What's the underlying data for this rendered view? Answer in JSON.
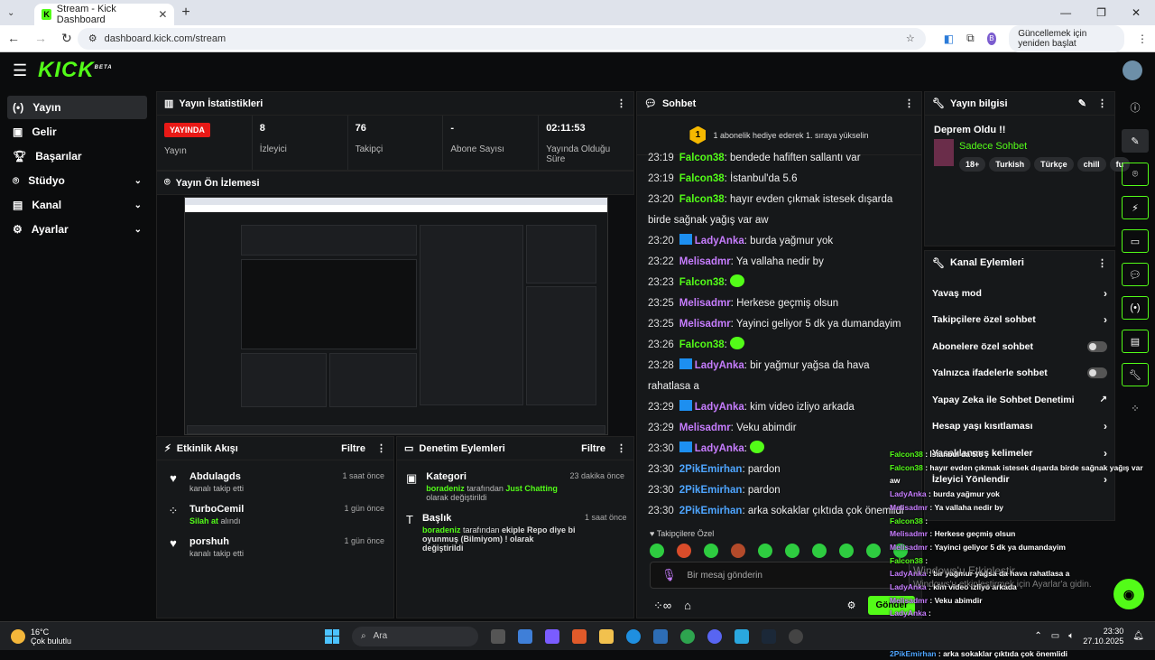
{
  "browser": {
    "tab_title": "Stream - Kick Dashboard",
    "url": "dashboard.kick.com/stream",
    "update_button": "Güncellemek için yeniden başlat",
    "profile_initial": "B"
  },
  "app": {
    "logo": "KICK",
    "logo_sup": "BETA"
  },
  "sidebar": {
    "items": [
      {
        "label": "Yayın",
        "icon": "broadcast-icon",
        "active": true
      },
      {
        "label": "Gelir",
        "icon": "revenue-icon"
      },
      {
        "label": "Başarılar",
        "icon": "trophy-icon"
      },
      {
        "label": "Stüdyo",
        "icon": "studio-icon",
        "expandable": true
      },
      {
        "label": "Kanal",
        "icon": "channel-icon",
        "expandable": true
      },
      {
        "label": "Ayarlar",
        "icon": "settings-icon",
        "expandable": true
      }
    ]
  },
  "stats": {
    "title": "Yayın İstatistikleri",
    "live_badge": "YAYINDA",
    "items": [
      {
        "value": "",
        "label": "Yayın"
      },
      {
        "value": "8",
        "label": "İzleyici"
      },
      {
        "value": "76",
        "label": "Takipçi"
      },
      {
        "value": "-",
        "label": "Abone Sayısı"
      },
      {
        "value": "02:11:53",
        "label": "Yayında Olduğu Süre"
      }
    ]
  },
  "preview": {
    "title": "Yayın Ön İzlemesi"
  },
  "activity": {
    "title": "Etkinlik Akışı",
    "filter": "Filtre",
    "rows": [
      {
        "name": "Abdulagds",
        "desc": "kanalı takip etti",
        "time": "1 saat önce",
        "icon": "heart-icon"
      },
      {
        "name": "TurboCemil",
        "desc_highlight": "Silah at",
        "desc": "alındı",
        "time": "1 gün önce",
        "icon": "reward-icon"
      },
      {
        "name": "porshuh",
        "desc": "kanalı takip etti",
        "time": "1 gün önce",
        "icon": "heart-icon"
      }
    ]
  },
  "moderation": {
    "title": "Denetim Eylemleri",
    "filter": "Filtre",
    "rows": [
      {
        "name": "Kategori",
        "user": "boradeniz",
        "mid": "tarafından",
        "hl": "Just Chatting",
        "rest": "olarak değiştirildi",
        "time": "23 dakika önce"
      },
      {
        "name": "Başlık",
        "user": "boradeniz",
        "mid": "tarafından",
        "hl": "",
        "rest": "ekiple Repo diye bi oyunmuş (Bilmiyom) ! olarak değiştirildi",
        "time": "1 saat önce"
      }
    ]
  },
  "chat": {
    "title": "Sohbet",
    "pinned": "1 abonelik hediye ederek 1. sıraya yükselin",
    "pinned_rank": "1",
    "messages": [
      {
        "t": "23:19",
        "u": "Falcon38",
        "c": "g",
        "m": "bendede hafiften sallantı var"
      },
      {
        "t": "23:19",
        "u": "Falcon38",
        "c": "g",
        "m": "İstanbul'da 5.6"
      },
      {
        "t": "23:20",
        "u": "Falcon38",
        "c": "g",
        "m": "hayır evden çıkmak istesek dışarda birde sağnak yağış var aw"
      },
      {
        "t": "23:20",
        "u": "LadyAnka",
        "c": "p",
        "m": "burda yağmur yok",
        "badge": true
      },
      {
        "t": "23:22",
        "u": "Melisadmr",
        "c": "p",
        "m": "Ya vallaha nedir by"
      },
      {
        "t": "23:23",
        "u": "Falcon38",
        "c": "g",
        "m": "",
        "emote": true
      },
      {
        "t": "23:25",
        "u": "Melisadmr",
        "c": "p",
        "m": "Herkese geçmiş olsun"
      },
      {
        "t": "23:25",
        "u": "Melisadmr",
        "c": "p",
        "m": "Yayinci geliyor 5 dk ya dumandayim"
      },
      {
        "t": "23:26",
        "u": "Falcon38",
        "c": "g",
        "m": "",
        "emote": true
      },
      {
        "t": "23:28",
        "u": "LadyAnka",
        "c": "p",
        "m": "bir yağmur yağsa da hava rahatlasa a",
        "badge": true
      },
      {
        "t": "23:29",
        "u": "LadyAnka",
        "c": "p",
        "m": "kim video izliyo arkada",
        "badge": true
      },
      {
        "t": "23:29",
        "u": "Melisadmr",
        "c": "p",
        "m": "Veku abimdir"
      },
      {
        "t": "23:30",
        "u": "LadyAnka",
        "c": "p",
        "m": "",
        "badge": true,
        "emote": true
      },
      {
        "t": "23:30",
        "u": "2PikEmirhan",
        "c": "b",
        "m": "pardon"
      },
      {
        "t": "23:30",
        "u": "2PikEmirhan",
        "c": "b",
        "m": "pardon"
      },
      {
        "t": "23:30",
        "u": "2PikEmirhan",
        "c": "b",
        "m": "arka sokaklar çıktıda çok önemlidi"
      }
    ],
    "followers_label": "Takipçilere Özel",
    "input_placeholder": "Bir mesaj gönderin",
    "send": "Gönder"
  },
  "info": {
    "title": "Yayın bilgisi",
    "stream_title": "Deprem Oldu !!",
    "category": "Sadece Sohbet",
    "tags": [
      "18+",
      "Turkish",
      "Türkçe",
      "chill",
      "fu"
    ]
  },
  "channel_actions": {
    "title": "Kanal Eylemleri",
    "rows": [
      {
        "label": "Yavaş mod",
        "kind": "chev"
      },
      {
        "label": "Takipçilere özel sohbet",
        "kind": "chev"
      },
      {
        "label": "Abonelere özel sohbet",
        "kind": "toggle"
      },
      {
        "label": "Yalnızca ifadelerle sohbet",
        "kind": "toggle"
      },
      {
        "label": "Yapay Zeka ile Sohbet Denetimi",
        "kind": "ext"
      },
      {
        "label": "Hesap yaşı kısıtlaması",
        "kind": "chev"
      },
      {
        "label": "Yasaklanmış kelimeler",
        "kind": "chev"
      },
      {
        "label": "İzleyici Yönlendir",
        "kind": "chev"
      }
    ]
  },
  "overlay": {
    "lines": [
      {
        "u": "Falcon38",
        "c": "g",
        "m": "İstanbul'da 5.6"
      },
      {
        "u": "Falcon38",
        "c": "g",
        "m": "hayır evden çıkmak istesek dışarda birde sağnak yağış var aw"
      },
      {
        "u": "LadyAnka",
        "c": "p",
        "m": "burda yağmur yok"
      },
      {
        "u": "Melisadmr",
        "c": "p",
        "m": "Ya vallaha nedir by"
      },
      {
        "u": "Falcon38",
        "c": "g",
        "m": ""
      },
      {
        "u": "Melisadmr",
        "c": "p",
        "m": "Herkese geçmiş olsun"
      },
      {
        "u": "Melisadmr",
        "c": "p",
        "m": "Yayinci geliyor 5 dk ya dumandayim"
      },
      {
        "u": "Falcon38",
        "c": "g",
        "m": ""
      },
      {
        "u": "LadyAnka",
        "c": "p",
        "m": "bir yağmur yağsa da hava rahatlasa a"
      },
      {
        "u": "LadyAnka",
        "c": "p",
        "m": "kim video izliyo arkada"
      },
      {
        "u": "Melisadmr",
        "c": "p",
        "m": "Veku abimdir"
      },
      {
        "u": "LadyAnka",
        "c": "p",
        "m": ""
      },
      {
        "u": "2PikEmirhan",
        "c": "b",
        "m": "pardon"
      },
      {
        "u": "2PikEmirhan",
        "c": "b",
        "m": "pardon"
      },
      {
        "u": "2PikEmirhan",
        "c": "b",
        "m": "arka sokaklar çıktıda çok önemlidi"
      }
    ]
  },
  "watermark": {
    "line1": "Windows'u Etkinleştir",
    "line2": "Windows'u etkinleştirmek için Ayarlar'a gidin."
  },
  "taskbar": {
    "temp": "16°C",
    "weather": "Çok bulutlu",
    "weather_badge": "1",
    "search": "Ara",
    "time": "23:30",
    "date": "27.10.2025"
  },
  "colors": {
    "brand": "#53fc18",
    "live": "#e91916",
    "bg": "#0b0c0d"
  }
}
